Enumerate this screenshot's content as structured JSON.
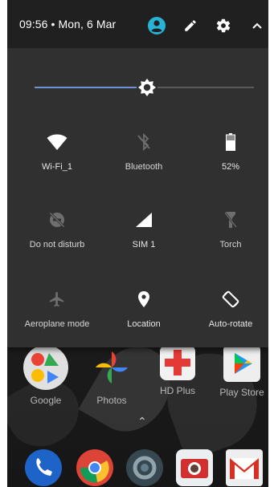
{
  "status": {
    "time_date": "09:56 • Mon, 6 Mar"
  },
  "header_icons": [
    "user-account-icon",
    "edit-pencil-icon",
    "settings-gear-icon",
    "collapse-chevron-icon"
  ],
  "brightness": {
    "level": 0.5,
    "fill_color": "#6c93d6"
  },
  "tiles": [
    {
      "label": "Wi-Fi_1",
      "icon": "wifi-icon",
      "active": true
    },
    {
      "label": "Bluetooth",
      "icon": "bluetooth-off-icon",
      "active": false
    },
    {
      "label": "52%",
      "icon": "battery-icon",
      "active": true
    },
    {
      "label": "Do not disturb",
      "icon": "do-not-disturb-off-icon",
      "active": false
    },
    {
      "label": "SIM 1",
      "icon": "signal-icon",
      "active": true
    },
    {
      "label": "Torch",
      "icon": "torch-off-icon",
      "active": false
    },
    {
      "label": "Aeroplane mode",
      "icon": "airplane-icon",
      "active": false
    },
    {
      "label": "Location",
      "icon": "location-pin-icon",
      "active": true
    },
    {
      "label": "Auto-rotate",
      "icon": "auto-rotate-icon",
      "active": true
    }
  ],
  "home": {
    "apps": [
      {
        "label": "Google"
      },
      {
        "label": "Photos"
      },
      {
        "label": "HD Plus"
      },
      {
        "label": "Play Store"
      }
    ],
    "dock": [
      "phone-icon",
      "chrome-icon",
      "settings-icon",
      "camera-icon",
      "gmail-icon"
    ]
  },
  "colors": {
    "shade_bg": "#303030",
    "header_bg": "#202020",
    "avatar_accent": "#26b3d6",
    "icon_on": "#ffffff",
    "icon_off": "#6e6e6e"
  }
}
